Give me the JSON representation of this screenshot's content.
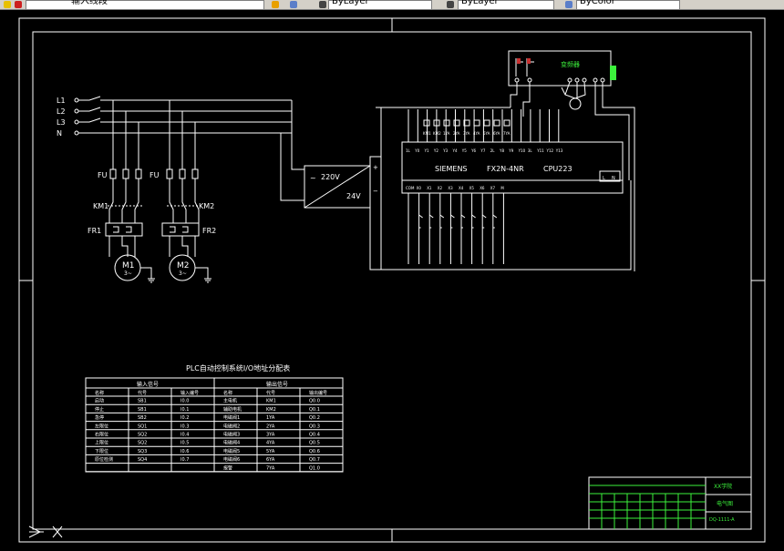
{
  "toolbar": {
    "layer_name": "输入线段",
    "linetype_1": "ByLayer",
    "linetype_2": "ByLayer",
    "color": "ByColor"
  },
  "power": {
    "lines": [
      "L1",
      "L2",
      "L3",
      "N"
    ],
    "fuse_label": "FU",
    "contactors": [
      "KM1",
      "KM2"
    ],
    "relays": [
      "FR1",
      "FR2"
    ],
    "motors": [
      {
        "name": "M1",
        "sub": "3~"
      },
      {
        "name": "M2",
        "sub": "3~"
      }
    ]
  },
  "psu": {
    "in": "220V",
    "out": "24V",
    "tilde": "~",
    "dc": "−"
  },
  "plc": {
    "brand": "SIEMENS",
    "model": "FX2N-4NR",
    "cpu": "CPU223",
    "top_terminals": [
      "1L",
      "Y0",
      "Y1",
      "Y2",
      "Y3",
      "Y4",
      "Y5",
      "Y6",
      "Y7",
      "2L",
      "Y8",
      "Y9",
      "Y10",
      "3L",
      "Y11",
      "Y12",
      "Y13"
    ],
    "top_devices": [
      "KM1",
      "KM2",
      "1YA",
      "2YA",
      "3YA",
      "4YA",
      "5YA",
      "6YA",
      "7YA"
    ],
    "bottom_terminals": [
      "COM",
      "X0",
      "X1",
      "X2",
      "X3",
      "X4",
      "X5",
      "X6",
      "X7",
      "M"
    ],
    "ln": [
      "L",
      "N"
    ]
  },
  "inverter": {
    "label": "变频器"
  },
  "io_table": {
    "title": "PLC自动控制系统I/O地址分配表",
    "input_header": "输入信号",
    "output_header": "输出信号",
    "columns": [
      "名称",
      "代号",
      "输入编号",
      "名称",
      "代号",
      "输出编号"
    ],
    "rows": [
      [
        "启动",
        "SB1",
        "I0.0",
        "主电机",
        "KM1",
        "Q0.0"
      ],
      [
        "停止",
        "SB1",
        "I0.1",
        "辅助电机",
        "KM2",
        "Q0.1"
      ],
      [
        "急停",
        "SB2",
        "I0.2",
        "电磁阀1",
        "1YA",
        "Q0.2"
      ],
      [
        "左限位",
        "SQ1",
        "I0.3",
        "电磁阀2",
        "2YA",
        "Q0.3"
      ],
      [
        "右限位",
        "SQ2",
        "I0.4",
        "电磁阀3",
        "3YA",
        "Q0.4"
      ],
      [
        "上限位",
        "SQ2",
        "I0.5",
        "电磁阀4",
        "4YA",
        "Q0.5"
      ],
      [
        "下限位",
        "SQ3",
        "I0.6",
        "电磁阀5",
        "5YA",
        "Q0.6"
      ],
      [
        "原位检测",
        "SQ4",
        "I0.7",
        "电磁阀6",
        "6YA",
        "Q0.7"
      ],
      [
        "",
        "",
        "",
        "报警",
        "7YA",
        "Q1.0"
      ]
    ]
  },
  "title_block": {
    "school": "XX学院",
    "drawing": "电气图",
    "number": "DQ-1111-A"
  },
  "colors": {
    "line": "#ffffff",
    "highlight": "#3cf23c",
    "background": "#000000"
  }
}
